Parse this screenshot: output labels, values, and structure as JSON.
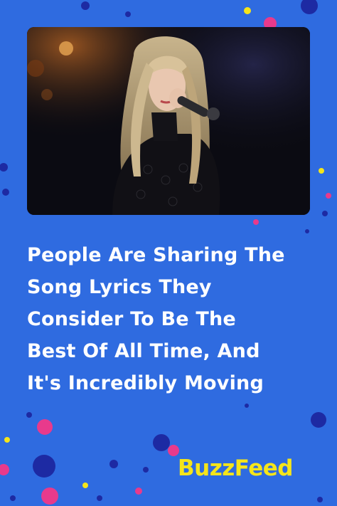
{
  "headline": {
    "lines": [
      "People Are Sharing The",
      "Song Lyrics They",
      "Consider To Be The",
      "Best Of All Time, And",
      "It's Incredibly Moving"
    ]
  },
  "brand": {
    "logo_text": "BuzzFeed"
  },
  "colors": {
    "background": "#2f6be0",
    "logo": "#f5e51a",
    "text": "#ffffff",
    "dot_pink": "#e83a8c",
    "dot_navy": "#1d2aa3",
    "dot_yellow": "#f5e51a"
  },
  "photo": {
    "subject": "performer-singing-into-microphone"
  }
}
